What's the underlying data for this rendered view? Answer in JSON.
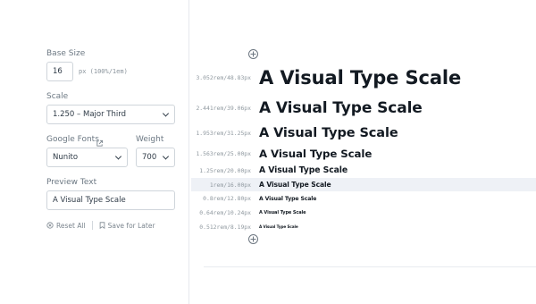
{
  "controls": {
    "base_size": {
      "label": "Base Size",
      "value": "16",
      "unit_hint": "px (100%/1em)"
    },
    "scale": {
      "label": "Scale",
      "selected": "1.250 – Major Third"
    },
    "font": {
      "label": "Google Fonts",
      "selected": "Nunito",
      "icon": "external-link-icon"
    },
    "weight": {
      "label": "Weight",
      "selected": "700"
    },
    "preview": {
      "label": "Preview Text",
      "value": "A Visual Type Scale"
    },
    "actions": {
      "reset": "Reset All",
      "save": "Save for Later"
    }
  },
  "scale_rows": [
    {
      "size": "3.052rem/48.83px",
      "text": "A Visual Type Scale",
      "highlighted": false
    },
    {
      "size": "2.441rem/39.06px",
      "text": "A Visual Type Scale",
      "highlighted": false
    },
    {
      "size": "1.953rem/31.25px",
      "text": "A Visual Type Scale",
      "highlighted": false
    },
    {
      "size": "1.563rem/25.00px",
      "text": "A Visual Type Scale",
      "highlighted": false
    },
    {
      "size": "1.25rem/20.00px",
      "text": "A Visual Type Scale",
      "highlighted": false
    },
    {
      "size": "1rem/16.00px",
      "text": "A Visual Type Scale",
      "highlighted": true
    },
    {
      "size": "0.8rem/12.80px",
      "text": "A Visual Type Scale",
      "highlighted": false
    },
    {
      "size": "0.64rem/10.24px",
      "text": "A Visual Type Scale",
      "highlighted": false
    },
    {
      "size": "0.512rem/8.19px",
      "text": "A Visual Type Scale",
      "highlighted": false
    }
  ],
  "colors": {
    "highlight": "#eef1f6",
    "text": "#131a22",
    "muted": "#8f989f"
  }
}
